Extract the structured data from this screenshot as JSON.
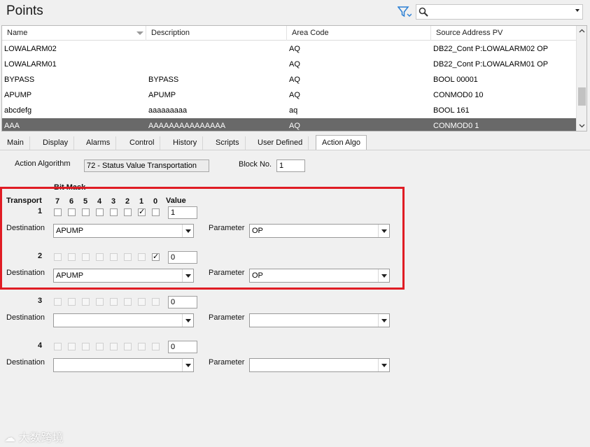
{
  "header": {
    "title": "Points",
    "search_placeholder": ""
  },
  "grid": {
    "columns": [
      "Name",
      "Description",
      "Area Code",
      "Source Address PV"
    ],
    "rows": [
      {
        "name": "LOWALARM02",
        "description": "",
        "area": "AQ",
        "source": "DB22_Cont P:LOWALARM02 OP",
        "selected": false
      },
      {
        "name": "LOWALARM01",
        "description": "",
        "area": "AQ",
        "source": "DB22_Cont P:LOWALARM01 OP",
        "selected": false
      },
      {
        "name": "BYPASS",
        "description": "BYPASS",
        "area": "AQ",
        "source": "BOOL 00001",
        "selected": false
      },
      {
        "name": "APUMP",
        "description": "APUMP",
        "area": "AQ",
        "source": "CONMOD0 10",
        "selected": false
      },
      {
        "name": "abcdefg",
        "description": "aaaaaaaaa",
        "area": "aq",
        "source": "BOOL 161",
        "selected": false
      },
      {
        "name": "AAA",
        "description": "AAAAAAAAAAAAAAA",
        "area": "AQ",
        "source": "CONMOD0 1",
        "selected": true
      }
    ]
  },
  "tabs": [
    {
      "label": "Main",
      "active": false
    },
    {
      "label": "Display",
      "active": false
    },
    {
      "label": "Alarms",
      "active": false
    },
    {
      "label": "Control",
      "active": false
    },
    {
      "label": "History",
      "active": false
    },
    {
      "label": "Scripts",
      "active": false
    },
    {
      "label": "User Defined",
      "active": false
    },
    {
      "label": "Action Algo",
      "active": true
    }
  ],
  "form": {
    "action_algorithm_label": "Action Algorithm",
    "action_algorithm_value": "72 - Status Value Transportation",
    "block_no_label": "Block No.",
    "block_no_value": "1",
    "bit_mask_label": "Bit Mask",
    "transport_label": "Transport",
    "value_label": "Value",
    "destination_label": "Destination",
    "parameter_label": "Parameter",
    "bits": [
      "7",
      "6",
      "5",
      "4",
      "3",
      "2",
      "1",
      "0"
    ],
    "transports": [
      {
        "num": "1",
        "checked": [
          false,
          false,
          false,
          false,
          false,
          false,
          true,
          false
        ],
        "enabled": true,
        "value": "1",
        "destination": "APUMP",
        "parameter": "OP"
      },
      {
        "num": "2",
        "checked": [
          false,
          false,
          false,
          false,
          false,
          false,
          false,
          true
        ],
        "enabled": false,
        "value": "0",
        "destination": "APUMP",
        "parameter": "OP"
      },
      {
        "num": "3",
        "checked": [
          false,
          false,
          false,
          false,
          false,
          false,
          false,
          false
        ],
        "enabled": false,
        "value": "0",
        "destination": "",
        "parameter": ""
      },
      {
        "num": "4",
        "checked": [
          false,
          false,
          false,
          false,
          false,
          false,
          false,
          false
        ],
        "enabled": false,
        "value": "0",
        "destination": "",
        "parameter": ""
      }
    ]
  },
  "colors": {
    "highlight": "#e01c24",
    "selected_row": "#696969"
  },
  "watermark": "大数跨境"
}
